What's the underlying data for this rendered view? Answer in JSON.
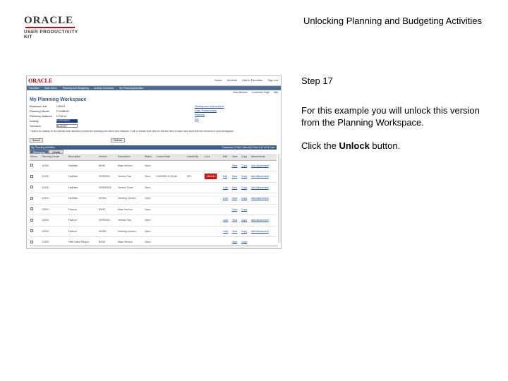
{
  "brand": {
    "name": "ORACLE",
    "sub": "USER PRODUCTIVITY KIT"
  },
  "doc_title": "Unlocking Planning and Budgeting Activities",
  "step": "Step 17",
  "description": "For this example you will unlock this version from the Planning Workspace.",
  "instruction": {
    "prefix": "Click the ",
    "bold": "Unlock",
    "suffix": " button."
  },
  "screenshot": {
    "logo": "ORACLE",
    "top_links": [
      "Home",
      "Worklist",
      "Add to Favorites",
      "Sign out"
    ],
    "nav": [
      "Favorites",
      "Main Menu",
      "Planning and Budgeting",
      "Activity Scenarios",
      "My Planning Activities"
    ],
    "tools": [
      "New Window",
      "Customize Page",
      "http"
    ],
    "title": "My Planning Workspace",
    "form": [
      {
        "label": "Business Unit",
        "value": "US001"
      },
      {
        "label": "Planning Model",
        "value": "FY08BUD"
      },
      {
        "label": "Planning Instance",
        "value": "FY08 v1"
      },
      {
        "label": "Activity",
        "value": "EXPENSES",
        "select": true
      },
      {
        "label": "Scenario",
        "value": "BUDGET",
        "select": true
      }
    ],
    "side_links": [
      "Workspace Instructions",
      "User Preferences",
      "Refresh",
      "Go"
    ],
    "note": "* Select an activity or the activity and scenario to show the planning line items and versions. Lock a version and click on the line item to open and work with the versions in your workspace.",
    "buttons": [
      "Search",
      "Refresh"
    ],
    "grid_title": "My Planning Activities",
    "grid_nav": "Customize | Find | View All | First 1-11 of 11 Last",
    "tabs": [
      "Workspace",
      "Details"
    ],
    "columns": [
      "Select",
      "Planning Center",
      "Description",
      "Version",
      "Description",
      "Status",
      "Locked Date",
      "Locked By",
      "Lock",
      "Edit",
      "View",
      "Copy",
      "Attachments"
    ],
    "rows": [
      {
        "center": "11000",
        "desc": "Facilities",
        "version": "BASE",
        "vdesc": "Base Version",
        "status": "Open",
        "locked": "",
        "by": "",
        "lock": "",
        "edit": "",
        "view": "View",
        "copy": "Copy",
        "attach": "Add Attachment"
      },
      {
        "center": "11000",
        "desc": "Facilities",
        "version": "VERSION",
        "vdesc": "Version Two",
        "status": "Open",
        "locked": "01/02/08 10:15 AM",
        "by": "VP1",
        "lock": "Unlock",
        "edit": "Edit",
        "view": "View",
        "copy": "Copy",
        "attach": "Add Attachment"
      },
      {
        "center": "11000",
        "desc": "Facilities",
        "version": "VERSION2",
        "vdesc": "Version Three",
        "status": "Open",
        "locked": "",
        "by": "",
        "lock": "",
        "edit": "Lock",
        "view": "View",
        "copy": "Copy",
        "attach": "Add Attachment"
      },
      {
        "center": "11000",
        "desc": "Facilities",
        "version": "WORK",
        "vdesc": "Working Version",
        "status": "Open",
        "locked": "",
        "by": "",
        "lock": "",
        "edit": "Lock",
        "view": "View",
        "copy": "Copy",
        "attach": "Add Attachment"
      },
      {
        "center": "12000",
        "desc": "Finance",
        "version": "BASE",
        "vdesc": "Base Version",
        "status": "Open",
        "locked": "",
        "by": "",
        "lock": "",
        "edit": "",
        "view": "View",
        "copy": "Copy",
        "attach": ""
      },
      {
        "center": "12000",
        "desc": "Finance",
        "version": "VERSION",
        "vdesc": "Version Two",
        "status": "Open",
        "locked": "",
        "by": "",
        "lock": "",
        "edit": "Lock",
        "view": "View",
        "copy": "Copy",
        "attach": "Add Attachment"
      },
      {
        "center": "12000",
        "desc": "Finance",
        "version": "WORK",
        "vdesc": "Working Version",
        "status": "Open",
        "locked": "",
        "by": "",
        "lock": "",
        "edit": "Lock",
        "view": "View",
        "copy": "Copy",
        "attach": "Add Attachment"
      },
      {
        "center": "21000",
        "desc": "Field Sales Region",
        "version": "BASE",
        "vdesc": "Base Version",
        "status": "Open",
        "locked": "",
        "by": "",
        "lock": "",
        "edit": "",
        "view": "View",
        "copy": "Copy",
        "attach": ""
      },
      {
        "center": "21000",
        "desc": "Field Sales Region",
        "version": "VERSION",
        "vdesc": "Version Two",
        "status": "Open",
        "locked": "",
        "by": "",
        "lock": "",
        "edit": "Lock",
        "view": "View",
        "copy": "Copy",
        "attach": "Add Attachment"
      },
      {
        "center": "21000",
        "desc": "Field Sales Region",
        "version": "WORK",
        "vdesc": "Working Version",
        "status": "Open",
        "locked": "",
        "by": "",
        "lock": "",
        "edit": "",
        "view": "View",
        "copy": "Copy",
        "attach": "Add Attachment"
      }
    ]
  }
}
